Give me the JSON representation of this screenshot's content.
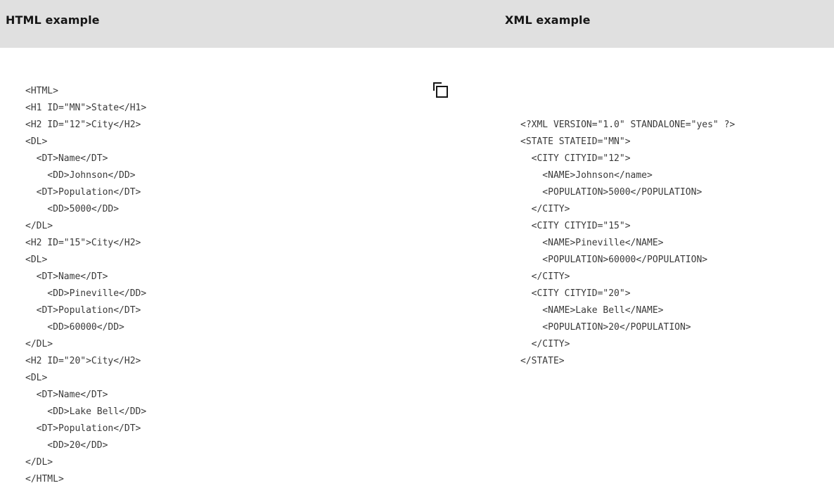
{
  "header": {
    "html_title": "HTML example",
    "xml_title": "XML example"
  },
  "copy_button": {
    "icon": "copy-icon"
  },
  "html_code": [
    "<HTML>",
    "<H1 ID=\"MN\">State</H1>",
    "<H2 ID=\"12\">City</H2>",
    "<DL>",
    "  <DT>Name</DT>",
    "    <DD>Johnson</DD>",
    "  <DT>Population</DT>",
    "    <DD>5000</DD>",
    "</DL>",
    "<H2 ID=\"15\">City</H2>",
    "<DL>",
    "  <DT>Name</DT>",
    "    <DD>Pineville</DD>",
    "  <DT>Population</DT>",
    "    <DD>60000</DD>",
    "</DL>",
    "<H2 ID=\"20\">City</H2>",
    "<DL>",
    "  <DT>Name</DT>",
    "    <DD>Lake Bell</DD>",
    "  <DT>Population</DT>",
    "    <DD>20</DD>",
    "</DL>",
    "</HTML>"
  ],
  "xml_code": [
    "<?XML VERSION=\"1.0\" STANDALONE=\"yes\" ?>",
    "<STATE STATEID=\"MN\">",
    "  <CITY CITYID=\"12\">",
    "    <NAME>Johnson</name>",
    "    <POPULATION>5000</POPULATION>",
    "  </CITY>",
    "  <CITY CITYID=\"15\">",
    "    <NAME>Pineville</NAME>",
    "    <POPULATION>60000</POPULATION>",
    "  </CITY>",
    "  <CITY CITYID=\"20\">",
    "    <NAME>Lake Bell</NAME>",
    "    <POPULATION>20</POPULATION>",
    "  </CITY>",
    "</STATE>"
  ]
}
